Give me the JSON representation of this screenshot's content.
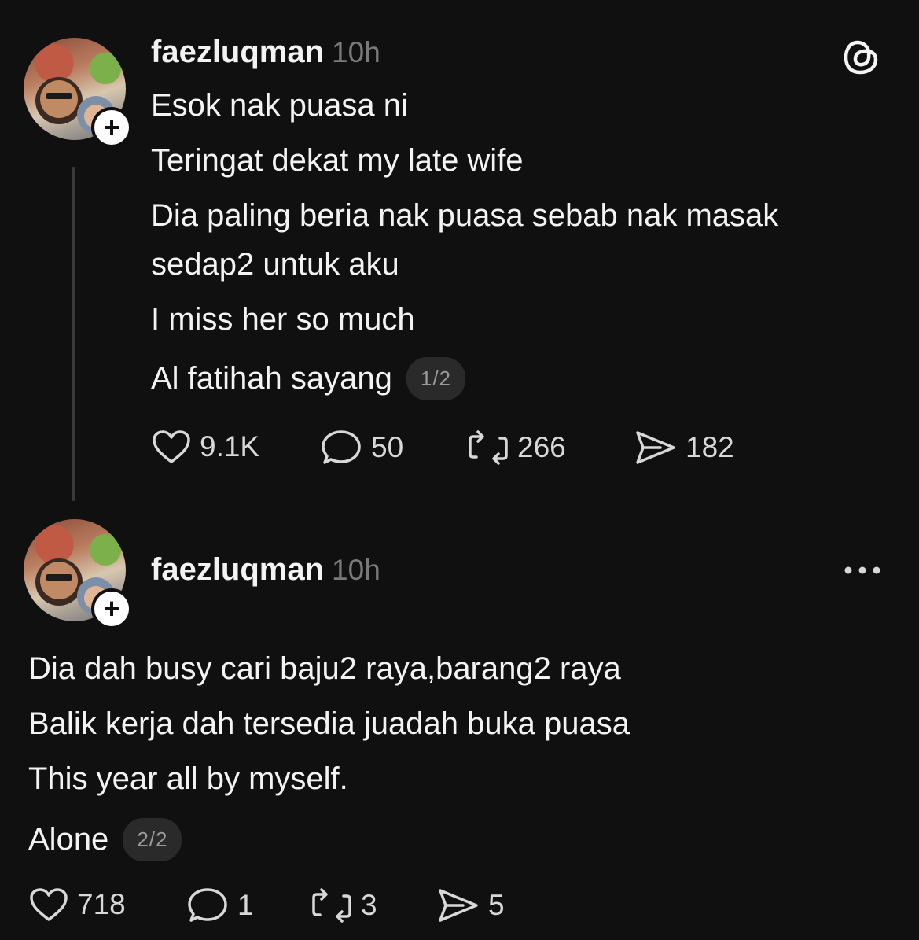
{
  "posts": [
    {
      "username": "faezluqman",
      "time": "10h",
      "lines": [
        "Esok nak puasa ni",
        "Teringat dekat my late wife",
        "Dia paling beria nak puasa sebab nak masak",
        "sedap2 untuk aku",
        "I miss her so much",
        "Al fatihah sayang"
      ],
      "page_badge": "1/2",
      "actions": {
        "likes": "9.1K",
        "replies": "50",
        "reposts": "266",
        "shares": "182"
      },
      "corner_icon": "threads-logo-icon"
    },
    {
      "username": "faezluqman",
      "time": "10h",
      "lines": [
        "Dia dah busy cari baju2 raya,barang2 raya",
        "Balik kerja dah tersedia juadah buka puasa",
        "This year all by myself.",
        "Alone"
      ],
      "page_badge": "2/2",
      "actions": {
        "likes": "718",
        "replies": "1",
        "reposts": "3",
        "shares": "5"
      },
      "corner_icon": "more-options-icon"
    }
  ],
  "colors": {
    "background": "#101010",
    "text": "#f3f3f3",
    "muted": "#7a7a7a",
    "badge_bg": "#2a2a2a"
  }
}
